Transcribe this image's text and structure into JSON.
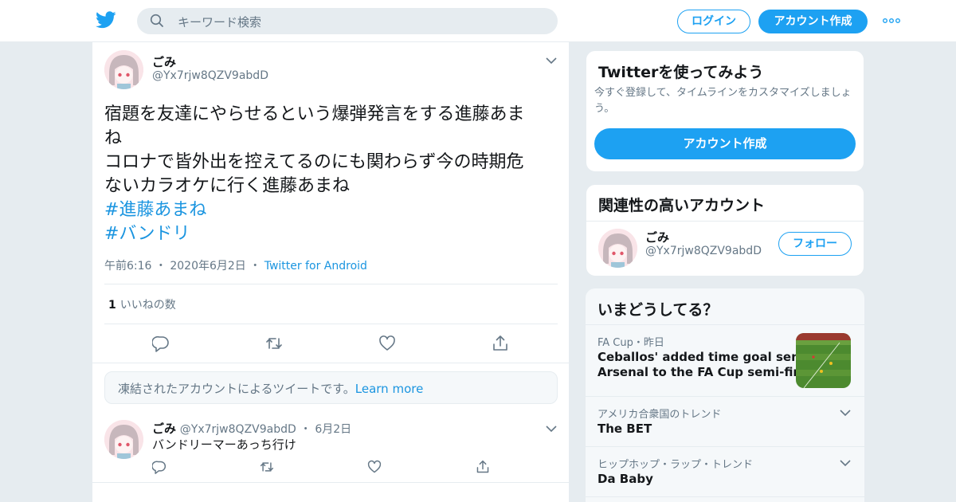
{
  "header": {
    "search_placeholder": "キーワード検索",
    "login_label": "ログイン",
    "signup_label": "アカウント作成",
    "brand_color": "#1da1f2"
  },
  "tweet": {
    "name": "ごみ",
    "handle": "@Yx7rjw8QZV9abdD",
    "lines": [
      "宿題を友達にやらせるという爆弾発言をする進藤あま",
      "ね",
      "コロナで皆外出を控えてるのにも関わらず今の時期危",
      "ないカラオケに行く進藤あまね"
    ],
    "hashtags": [
      "#進藤あまね",
      "#バンドリ"
    ],
    "time": "午前6:16",
    "date": "2020年6月2日",
    "source": "Twitter for Android",
    "like_count": "1",
    "like_label": "いいねの数"
  },
  "notice": {
    "text": "凍結されたアカウントによるツイートです。",
    "link": "Learn more"
  },
  "reply": {
    "name": "ごみ",
    "handle": "@Yx7rjw8QZV9abdD",
    "date": "6月2日",
    "text": "バンドリーマーあっち行け"
  },
  "sidebar": {
    "try": {
      "title": "Twitterを使ってみよう",
      "subtitle": "今すぐ登録して、タイムラインをカスタマイズしましょう。",
      "button": "アカウント作成"
    },
    "related": {
      "title": "関連性の高いアカウント",
      "name": "ごみ",
      "handle": "@Yx7rjw8QZV9abdD",
      "follow": "フォロー"
    },
    "trends": {
      "title": "いまどうしてる？",
      "items": [
        {
          "meta": "FA Cup・昨日",
          "name_lines": [
            "Ceballos' added time goal sends",
            "Arsenal to the FA Cup semi-finals"
          ]
        },
        {
          "meta": "アメリカ合衆国のトレンド",
          "name": "The BET"
        },
        {
          "meta": "ヒップホップ・ラップ・トレンド",
          "name": "Da Baby"
        }
      ]
    }
  }
}
